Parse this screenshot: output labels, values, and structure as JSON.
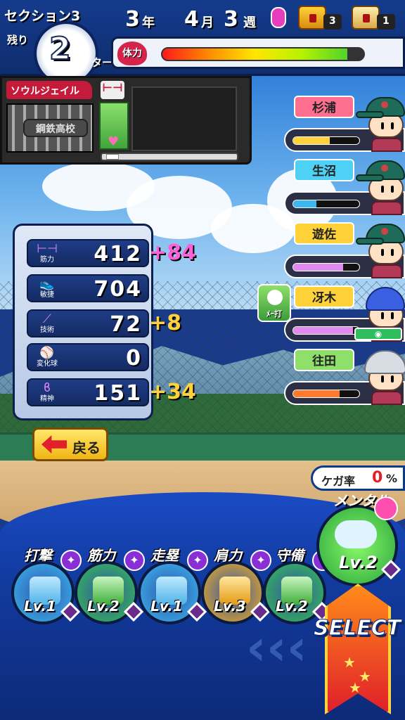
{
  "header": {
    "section": "セクション3",
    "remaining_label": "残り",
    "remaining_turns": "2",
    "turn_label": "ターン",
    "year_num": "3",
    "year_unit": "年",
    "month_num": "4",
    "month_unit": "月",
    "week_num": "3",
    "week_unit": "週",
    "chest_gold_count": "3",
    "chest_silver_count": "1",
    "stamina_label": "体力",
    "stamina_level": 0.92
  },
  "soul_jail": {
    "label": "ソウルジェイル",
    "plate_text": "鋼鉄高校"
  },
  "players": [
    {
      "name": "杉浦",
      "color": "#ff6f8f",
      "bar": 0.55,
      "bar_color": "#ffd23a"
    },
    {
      "name": "生沼",
      "color": "#4fd0f5",
      "bar": 0.35,
      "bar_color": "#3ab8f0"
    },
    {
      "name": "遊佐",
      "color": "#ffd23a",
      "bar": 0.75,
      "bar_color": "#e08af0"
    },
    {
      "name": "冴木",
      "color": "#ffd23a",
      "bar": 0.9,
      "bar_color": "#e08af0"
    },
    {
      "name": "往田",
      "color": "#8ee06a",
      "bar": 0.7,
      "bar_color": "#ff7a2a"
    }
  ],
  "skill_chip": {
    "label": "ﾒｰ打"
  },
  "stats": [
    {
      "label": "筋力",
      "icon": "dumbbell-icon",
      "value": "412",
      "bonus": "+84",
      "bonus_color": "#ff5fd8"
    },
    {
      "label": "敏捷",
      "icon": "shoe-icon",
      "value": "704",
      "bonus": "",
      "bonus_color": "#ffd23a"
    },
    {
      "label": "技術",
      "icon": "bat-icon",
      "value": "72",
      "bonus": "+8",
      "bonus_color": "#ffd23a"
    },
    {
      "label": "変化球",
      "icon": "ball-icon",
      "value": "0",
      "bonus": "",
      "bonus_color": "#ffd23a"
    },
    {
      "label": "精神",
      "icon": "spirit-icon",
      "value": "151",
      "bonus": "+34",
      "bonus_color": "#ffd23a"
    }
  ],
  "back_button": {
    "label": "戻る"
  },
  "injury": {
    "label": "ケガ率",
    "value": "0",
    "unit": "%"
  },
  "practices": [
    {
      "name": "打撃",
      "level": "Lv.1",
      "color": "#3ab8f0"
    },
    {
      "name": "筋力",
      "level": "Lv.2",
      "color": "#36c24a"
    },
    {
      "name": "走塁",
      "level": "Lv.1",
      "color": "#3ab8f0"
    },
    {
      "name": "肩力",
      "level": "Lv.3",
      "color": "#f5b01a"
    },
    {
      "name": "守備",
      "level": "Lv.2",
      "color": "#36c24a"
    }
  ],
  "mental": {
    "name": "メンタル",
    "level": "Lv.2"
  },
  "select_button": {
    "label": "SELECT"
  }
}
